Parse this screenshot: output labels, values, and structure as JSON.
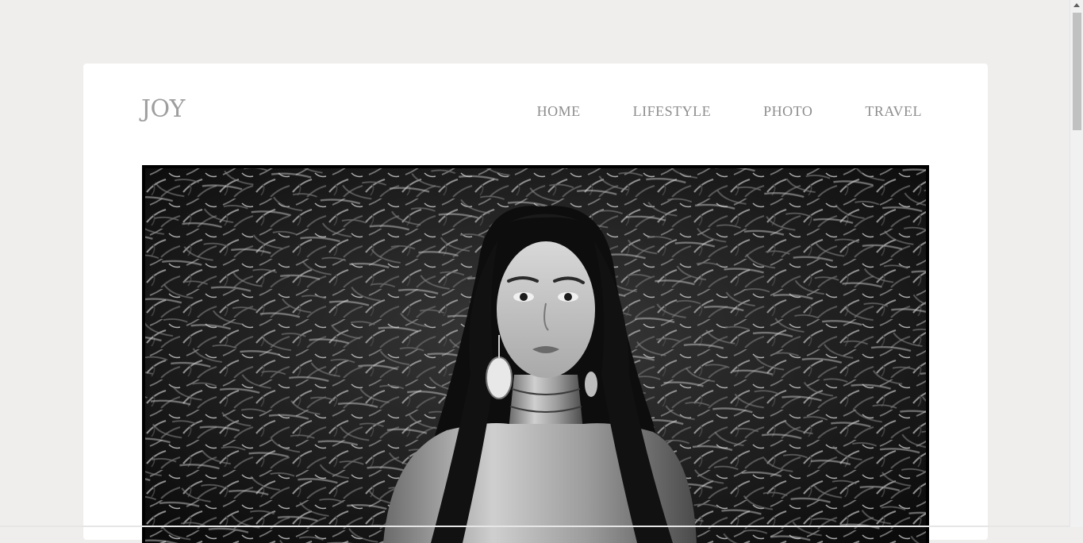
{
  "site": {
    "logo": "JOY"
  },
  "nav": {
    "items": [
      {
        "label": "HOME"
      },
      {
        "label": "LIFESTYLE"
      },
      {
        "label": "PHOTO"
      },
      {
        "label": "TRAVEL"
      }
    ]
  },
  "hero": {
    "style": "black-and-white"
  },
  "colors": {
    "page_background": "#efeeec",
    "card_background": "#ffffff",
    "nav_text": "#8d8d8d",
    "logo_text": "#9e9e9e"
  }
}
